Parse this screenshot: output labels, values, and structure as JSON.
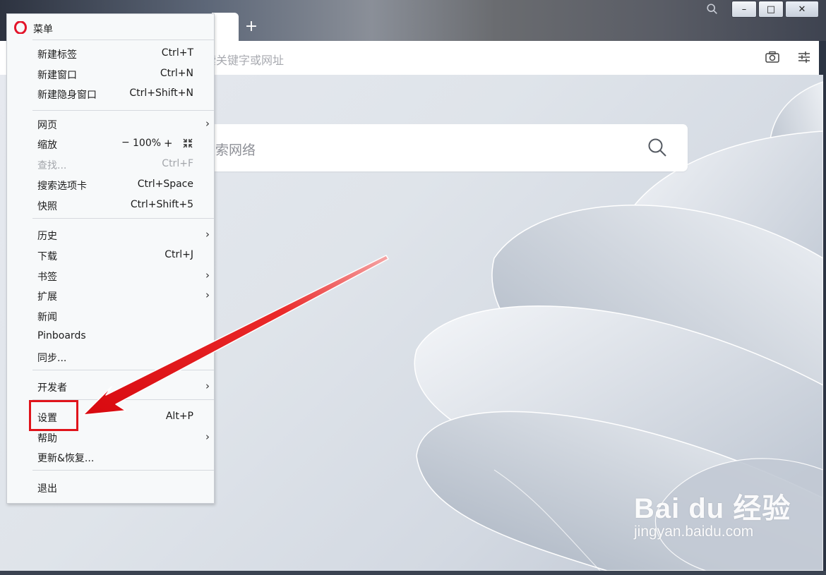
{
  "window": {
    "new_tab_symbol": "+",
    "minimize_symbol": "–",
    "maximize_symbol": "□",
    "close_symbol": "✕"
  },
  "address_bar": {
    "placeholder": "索关键字或网址",
    "icons": [
      "camera-icon",
      "easy-setup-icon"
    ]
  },
  "speed_dial": {
    "search_placeholder": "搜索网络",
    "search_icon": "search-icon"
  },
  "menu": {
    "title": "菜单",
    "items": {
      "new_tab": {
        "label": "新建标签",
        "shortcut": "Ctrl+T"
      },
      "new_window": {
        "label": "新建窗口",
        "shortcut": "Ctrl+N"
      },
      "new_private": {
        "label": "新建隐身窗口",
        "shortcut": "Ctrl+Shift+N"
      },
      "page": {
        "label": "网页",
        "arrow": "›"
      },
      "zoom": {
        "label": "缩放",
        "minus": "−",
        "value": "100%",
        "plus": "+"
      },
      "find": {
        "label": "查找...",
        "shortcut": "Ctrl+F"
      },
      "search_tabs": {
        "label": "搜索选项卡",
        "shortcut": "Ctrl+Space"
      },
      "snapshot": {
        "label": "快照",
        "shortcut": "Ctrl+Shift+5"
      },
      "history": {
        "label": "历史",
        "arrow": "›"
      },
      "downloads": {
        "label": "下载",
        "shortcut": "Ctrl+J"
      },
      "bookmarks": {
        "label": "书签",
        "arrow": "›"
      },
      "extensions": {
        "label": "扩展",
        "arrow": "›"
      },
      "news": {
        "label": "新闻"
      },
      "pinboards": {
        "label": "Pinboards"
      },
      "sync": {
        "label": "同步..."
      },
      "developer": {
        "label": "开发者",
        "arrow": "›"
      },
      "settings": {
        "label": "设置",
        "shortcut": "Alt+P"
      },
      "help": {
        "label": "帮助",
        "arrow": "›"
      },
      "update": {
        "label": "更新&恢复..."
      },
      "exit": {
        "label": "退出"
      }
    }
  },
  "annotation": {
    "highlight_color": "#e0141b"
  },
  "watermark": {
    "brand": "Bai du 经验",
    "url": "jingyan.baidu.com"
  }
}
